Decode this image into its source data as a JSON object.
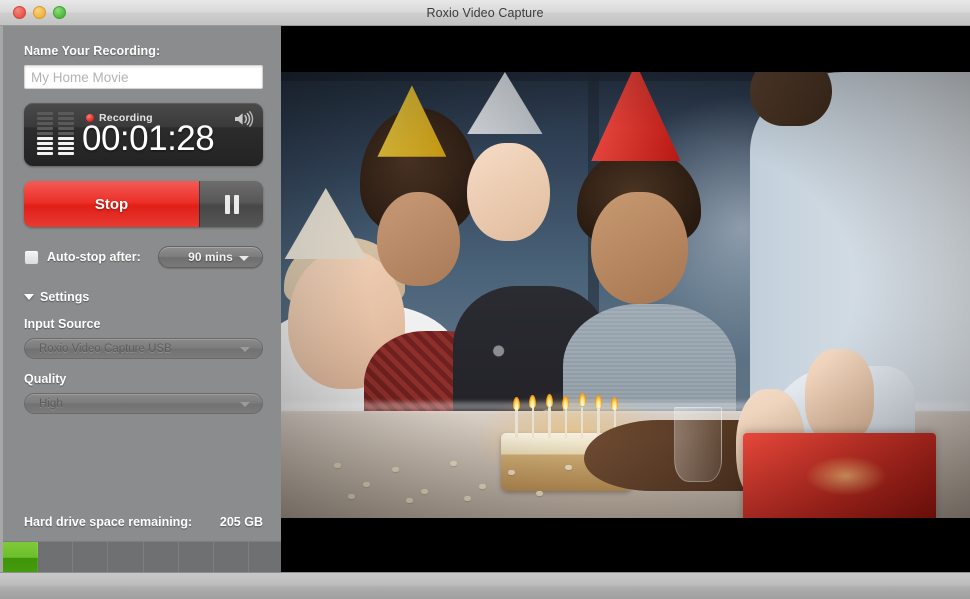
{
  "window": {
    "title": "Roxio Video Capture",
    "controls": {
      "close": "close",
      "minimize": "minimize",
      "zoom": "zoom"
    }
  },
  "sidebar": {
    "name_section": {
      "label": "Name Your Recording:",
      "input_value": "",
      "input_placeholder": "My Home Movie"
    },
    "timer": {
      "status_label": "Recording",
      "elapsed": "00:01:28",
      "meter_levels": [
        4,
        4
      ],
      "meter_total": 9
    },
    "transport": {
      "stop_label": "Stop",
      "pause_label": "Pause"
    },
    "auto_stop": {
      "label": "Auto-stop after:",
      "checked": false,
      "value": "90 mins"
    },
    "settings": {
      "title": "Settings",
      "expanded": true,
      "input_source": {
        "label": "Input Source",
        "value": "Roxio Video Capture USB"
      },
      "quality": {
        "label": "Quality",
        "value": "High"
      }
    },
    "storage": {
      "label": "Hard drive space remaining:",
      "value": "205 GB",
      "fill_percent": 12,
      "segments": 8,
      "fill_color": "#6cbf2b"
    }
  },
  "preview": {
    "scene_description": "Birthday party video preview: child blowing out candles on a cake surrounded by family in party hats",
    "letterbox_color": "#000000"
  },
  "colors": {
    "sidebar_bg": "#8b8c8d",
    "titlebar_bg": "#d4d4d4",
    "stop_red": "#e01f18",
    "accent_green": "#6cbf2b",
    "recording_dot": "#d8201b"
  }
}
